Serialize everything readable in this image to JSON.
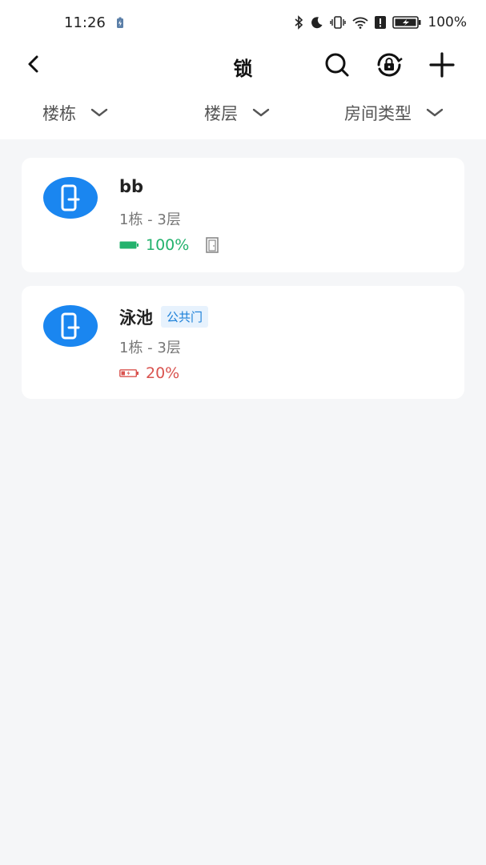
{
  "status": {
    "time": "11:26",
    "battery": "100%"
  },
  "nav": {
    "title": "锁"
  },
  "filters": [
    {
      "label": "楼栋"
    },
    {
      "label": "楼层"
    },
    {
      "label": "房间类型"
    }
  ],
  "locks": [
    {
      "name": "bb",
      "tag": "",
      "location": "1栋 - 3层",
      "battery": "100%",
      "battery_level": 100,
      "battery_color": "#23b26d"
    },
    {
      "name": "泳池",
      "tag": "公共门",
      "location": "1栋 - 3层",
      "battery": "20%",
      "battery_level": 20,
      "battery_color": "#d9534f"
    }
  ],
  "colors": {
    "accent": "#1a86f0",
    "ok": "#23b26d",
    "low": "#d9534f"
  }
}
